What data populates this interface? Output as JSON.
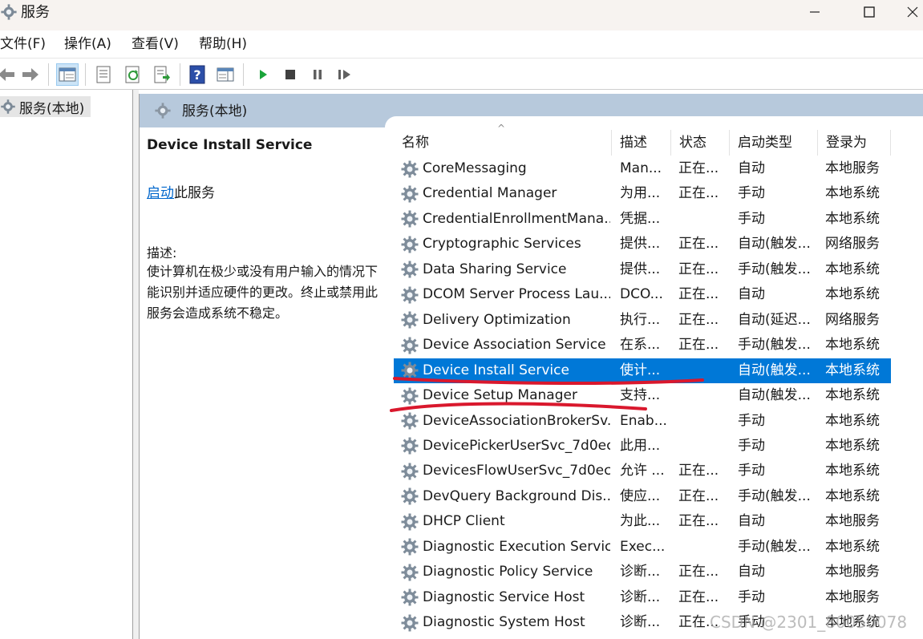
{
  "window": {
    "title": "服务",
    "icon": "gear-icon",
    "controls": [
      "minimize-icon",
      "maximize-icon",
      "close-icon"
    ]
  },
  "menu": {
    "items": [
      "文件(F)",
      "操作(A)",
      "查看(V)",
      "帮助(H)"
    ]
  },
  "toolbar": {
    "buttons": [
      "back-arrow-icon",
      "forward-arrow-icon",
      "show-hide-console-tree-icon",
      "properties-icon",
      "refresh-icon",
      "export-list-icon",
      "help-icon",
      "show-hide-action-pane-icon",
      "start-service-icon",
      "stop-service-icon",
      "pause-service-icon",
      "resume-service-icon"
    ]
  },
  "tree": {
    "root": "服务(本地)"
  },
  "panel": {
    "header": "服务(本地)",
    "selected_service": "Device Install Service",
    "action_link": "启动",
    "action_suffix": "此服务",
    "desc_label": "描述:",
    "description": "使计算机在极少或没有用户输入的情况下能识别并适应硬件的更改。终止或禁用此服务会造成系统不稳定。"
  },
  "table": {
    "headers": {
      "name": "名称",
      "desc": "描述",
      "status": "状态",
      "startup": "启动类型",
      "logon": "登录为"
    },
    "rows": [
      {
        "name": "CoreMessaging",
        "desc": "Man...",
        "status": "正在...",
        "startup": "自动",
        "logon": "本地服务"
      },
      {
        "name": "Credential Manager",
        "desc": "为用...",
        "status": "正在...",
        "startup": "手动",
        "logon": "本地系统"
      },
      {
        "name": "CredentialEnrollmentMana...",
        "desc": "凭据...",
        "status": "",
        "startup": "手动",
        "logon": "本地系统"
      },
      {
        "name": "Cryptographic Services",
        "desc": "提供...",
        "status": "正在...",
        "startup": "自动(触发...",
        "logon": "网络服务"
      },
      {
        "name": "Data Sharing Service",
        "desc": "提供...",
        "status": "正在...",
        "startup": "手动(触发...",
        "logon": "本地系统"
      },
      {
        "name": "DCOM Server Process Lau...",
        "desc": "DCO...",
        "status": "正在...",
        "startup": "自动",
        "logon": "本地系统"
      },
      {
        "name": "Delivery Optimization",
        "desc": "执行...",
        "status": "正在...",
        "startup": "自动(延迟...",
        "logon": "网络服务"
      },
      {
        "name": "Device Association Service",
        "desc": "在系...",
        "status": "正在...",
        "startup": "手动(触发...",
        "logon": "本地系统"
      },
      {
        "name": "Device Install Service",
        "desc": "使计...",
        "status": "",
        "startup": "自动(触发...",
        "logon": "本地系统",
        "selected": true
      },
      {
        "name": "Device Setup Manager",
        "desc": "支持...",
        "status": "",
        "startup": "自动(触发...",
        "logon": "本地系统"
      },
      {
        "name": "DeviceAssociationBrokerSv...",
        "desc": "Enab...",
        "status": "",
        "startup": "手动",
        "logon": "本地系统"
      },
      {
        "name": "DevicePickerUserSvc_7d0ec",
        "desc": "此用...",
        "status": "",
        "startup": "手动",
        "logon": "本地系统"
      },
      {
        "name": "DevicesFlowUserSvc_7d0ec",
        "desc": "允许 ...",
        "status": "正在...",
        "startup": "手动",
        "logon": "本地系统"
      },
      {
        "name": "DevQuery Background Dis...",
        "desc": "使应...",
        "status": "正在...",
        "startup": "手动(触发...",
        "logon": "本地系统"
      },
      {
        "name": "DHCP Client",
        "desc": "为此...",
        "status": "正在...",
        "startup": "自动",
        "logon": "本地服务"
      },
      {
        "name": "Diagnostic Execution Service",
        "desc": "Exec...",
        "status": "",
        "startup": "手动(触发...",
        "logon": "本地系统"
      },
      {
        "name": "Diagnostic Policy Service",
        "desc": "诊断...",
        "status": "正在...",
        "startup": "自动",
        "logon": "本地服务"
      },
      {
        "name": "Diagnostic Service Host",
        "desc": "诊断...",
        "status": "正在...",
        "startup": "手动",
        "logon": "本地服务"
      },
      {
        "name": "Diagnostic System Host",
        "desc": "诊断...",
        "status": "正在...",
        "startup": "手动",
        "logon": "本地系统"
      }
    ]
  },
  "colors": {
    "selection": "#0078d7",
    "header_band": "#b7c9dc",
    "link": "#0066cc",
    "annotation": "#d9182d"
  },
  "watermark": "CSDN @2301_80050078"
}
